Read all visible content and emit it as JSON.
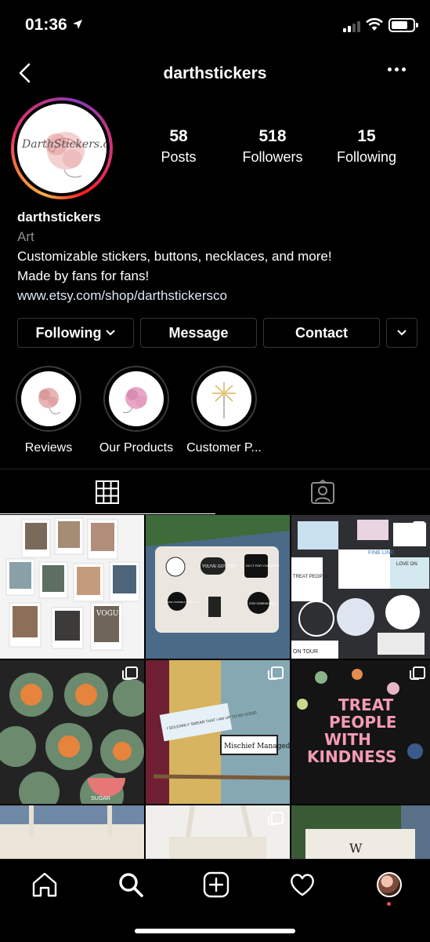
{
  "status_bar": {
    "time": "01:36"
  },
  "header": {
    "username": "darthstickers"
  },
  "profile": {
    "avatar_text": "DarthStickers.co",
    "stats": [
      {
        "value": "58",
        "label": "Posts"
      },
      {
        "value": "518",
        "label": "Followers"
      },
      {
        "value": "15",
        "label": "Following"
      }
    ],
    "bio": {
      "name": "darthstickers",
      "category": "Art",
      "line1": "Customizable stickers, buttons, necklaces, and more!",
      "line2": "Made by fans for fans!",
      "link": "www.etsy.com/shop/darthstickersco"
    }
  },
  "actions": {
    "following_label": "Following",
    "message_label": "Message",
    "contact_label": "Contact"
  },
  "highlights": [
    {
      "label": "Reviews",
      "icon": "rose-icon"
    },
    {
      "label": "Our Products",
      "icon": "rose-icon"
    },
    {
      "label": "Customer P...",
      "icon": "daisy-icon"
    }
  ],
  "grid": {
    "tile_texts": {
      "sticker_laptop_1": "YOU'VE GOT THIS",
      "sticker_laptop_2": "DO IT FOR YOURSELF",
      "sticker_laptop_3": "HAVE YOURSELF A PRIORITY",
      "sticker_laptop_4": "STAY SOMEWHERE",
      "stickers_fine_line": "FINE LINE",
      "stickers_treat": "TREAT PEOPLE",
      "stickers_on_tour": "ON TOUR",
      "stickers_love_on": "LOVE ON",
      "stickers_solemnly": "I SOLEMNLY SWEAR THAT I AM UP TO NO GOOD",
      "stickers_mischief": "Mischief Managed",
      "tshirt_text": "TREAT PEOPLE WITH KINDNESS",
      "vogue": "VOGUE",
      "sugar": "SUGAR",
      "tote_w": "W"
    }
  },
  "colors": {
    "background": "#000000",
    "secondary_text": "#8e8e8e",
    "border": "#363636",
    "notification": "#ed4956"
  }
}
